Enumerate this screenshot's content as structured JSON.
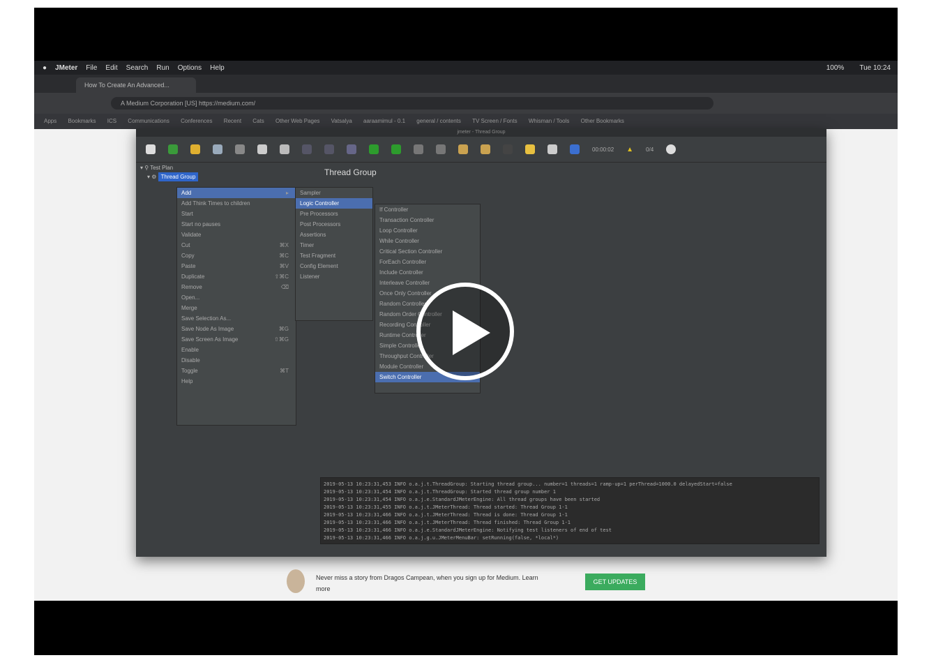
{
  "macbar": {
    "app": "JMeter",
    "menus": [
      "File",
      "Edit",
      "Search",
      "Run",
      "Options",
      "Help"
    ],
    "battery": "100%",
    "time": "Tue 10:24"
  },
  "browser": {
    "tab_title": "How To Create An Advanced...",
    "url": "A Medium Corporation [US]  https://medium.com/",
    "bookmarks": [
      "Apps",
      "Bookmarks",
      "ICS",
      "Communications",
      "Conferences",
      "Recent",
      "Cats",
      "Other Web Pages",
      "Vatsalya",
      "aaraamimul - 0.1",
      "general / contents",
      "TV Screen / Fonts",
      "Whisman / Tools",
      "Other Bookmarks"
    ]
  },
  "jmeter": {
    "window_title": "jmeter - Thread Group",
    "tree": {
      "test_plan": "Test Plan",
      "thread_group": "Thread Group"
    },
    "panel_title": "Thread Group",
    "toolbar_time": "00:00:02",
    "toolbar_count": "0/4",
    "context_menu": [
      {
        "label": "Add",
        "shortcut": ""
      },
      {
        "label": "Add Think Times to children",
        "shortcut": ""
      },
      {
        "label": "Start",
        "shortcut": ""
      },
      {
        "label": "Start no pauses",
        "shortcut": ""
      },
      {
        "label": "Validate",
        "shortcut": ""
      },
      {
        "label": "Cut",
        "shortcut": "⌘X"
      },
      {
        "label": "Copy",
        "shortcut": "⌘C"
      },
      {
        "label": "Paste",
        "shortcut": "⌘V"
      },
      {
        "label": "Duplicate",
        "shortcut": "⇧⌘C"
      },
      {
        "label": "Remove",
        "shortcut": "⌫"
      },
      {
        "label": "Open...",
        "shortcut": ""
      },
      {
        "label": "Merge",
        "shortcut": ""
      },
      {
        "label": "Save Selection As...",
        "shortcut": ""
      },
      {
        "label": "Save Node As Image",
        "shortcut": "⌘G"
      },
      {
        "label": "Save Screen As Image",
        "shortcut": "⇧⌘G"
      },
      {
        "label": "Enable",
        "shortcut": ""
      },
      {
        "label": "Disable",
        "shortcut": ""
      },
      {
        "label": "Toggle",
        "shortcut": "⌘T"
      },
      {
        "label": "Help",
        "shortcut": ""
      }
    ],
    "add_submenu": [
      "Sampler",
      "Logic Controller",
      "Pre Processors",
      "Post Processors",
      "Assertions",
      "Timer",
      "Test Fragment",
      "Config Element",
      "Listener"
    ],
    "logic_submenu": [
      "If Controller",
      "Transaction Controller",
      "Loop Controller",
      "While Controller",
      "Critical Section Controller",
      "ForEach Controller",
      "Include Controller",
      "Interleave Controller",
      "Once Only Controller",
      "Random Controller",
      "Random Order Controller",
      "Recording Controller",
      "Runtime Controller",
      "Simple Controller",
      "Throughput Controller",
      "Module Controller",
      "Switch Controller"
    ],
    "log_lines": [
      "2019-05-13 10:23:31,453 INFO o.a.j.t.ThreadGroup: Starting thread group... number=1 threads=1 ramp-up=1 perThread=1000.0 delayedStart=false",
      "2019-05-13 10:23:31,454 INFO o.a.j.t.ThreadGroup: Started thread group number 1",
      "2019-05-13 10:23:31,454 INFO o.a.j.e.StandardJMeterEngine: All thread groups have been started",
      "2019-05-13 10:23:31,455 INFO o.a.j.t.JMeterThread: Thread started: Thread Group 1-1",
      "2019-05-13 10:23:31,466 INFO o.a.j.t.JMeterThread: Thread is done: Thread Group 1-1",
      "2019-05-13 10:23:31,466 INFO o.a.j.t.JMeterThread: Thread finished: Thread Group 1-1",
      "2019-05-13 10:23:31,466 INFO o.a.j.e.StandardJMeterEngine: Notifying test listeners of end of test",
      "2019-05-13 10:23:31,466 INFO o.a.j.g.u.JMeterMenuBar: setRunning(false, *local*)"
    ]
  },
  "banner": {
    "text": "Never miss a story from Dragos Campean, when you sign up for Medium. Learn more",
    "button": "GET UPDATES"
  },
  "colors": {
    "jmeter_bg": "#3c3f41",
    "selection": "#2f65ca",
    "menu_highlight": "#4b6eaf",
    "medium_green": "#3bab5e"
  }
}
